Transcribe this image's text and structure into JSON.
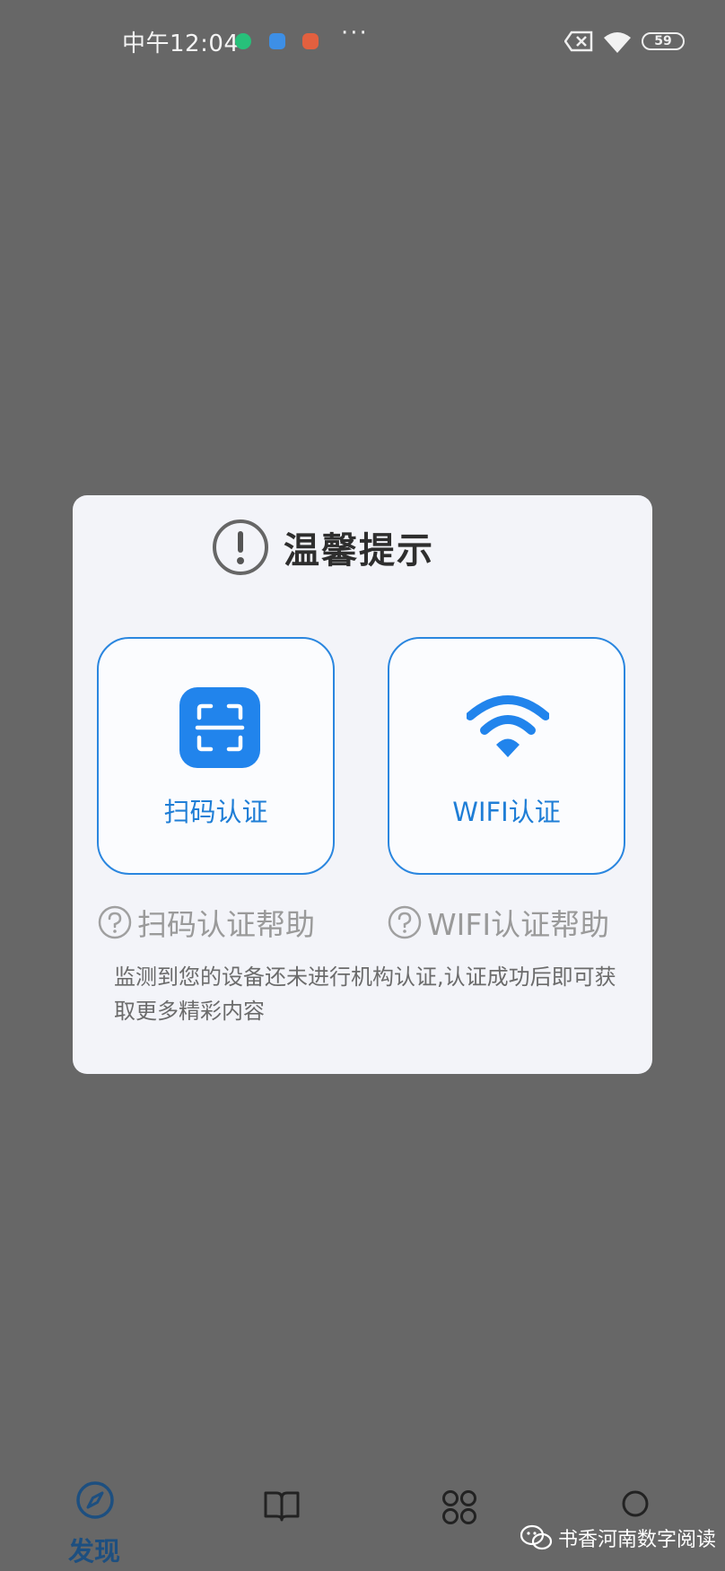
{
  "status_bar": {
    "time": "中午12:04",
    "more": "···",
    "battery": "59",
    "icons": [
      "shield-app-icon",
      "download-app-icon",
      "avatar-app-icon",
      "sim-off-icon",
      "wifi-icon",
      "battery-icon"
    ]
  },
  "dialog": {
    "title": "温馨提示",
    "title_icon": "exclamation-circle-icon",
    "scan_card": {
      "label": "扫码认证",
      "icon": "scan-qr-icon"
    },
    "wifi_card": {
      "label": "WIFI认证",
      "icon": "wifi-icon"
    },
    "scan_help": "扫码认证帮助",
    "wifi_help": "WIFI认证帮助",
    "description": "监测到您的设备还未进行机构认证,认证成功后即可获取更多精彩内容",
    "accent_color": "#2184ec"
  },
  "bottom_nav": {
    "items": [
      {
        "label": "发现",
        "icon": "compass-icon",
        "active": true
      },
      {
        "label": "",
        "icon": "book-icon"
      },
      {
        "label": "",
        "icon": "apps-grid-icon"
      },
      {
        "label": "",
        "icon": "profile-icon"
      }
    ],
    "active_color": "#1d4f80"
  },
  "watermark": {
    "text": "书香河南数字阅读",
    "icon": "wechat-icon"
  }
}
